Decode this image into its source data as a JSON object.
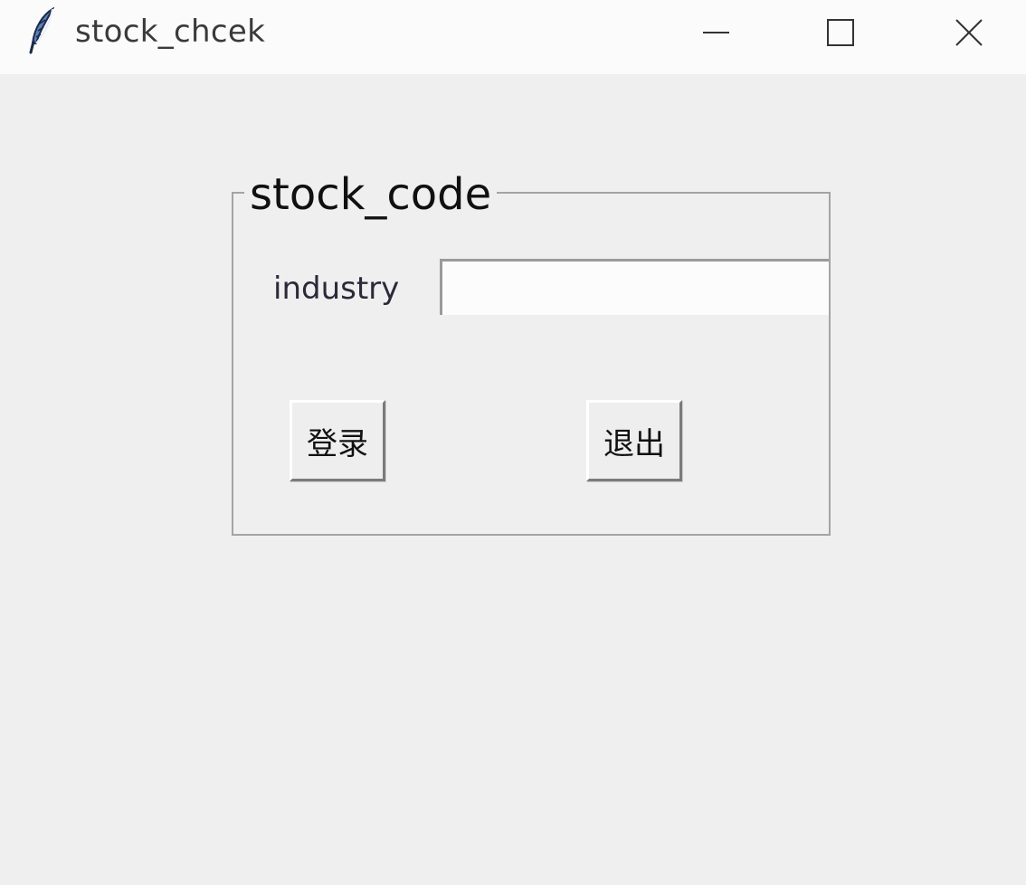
{
  "window": {
    "title": "stock_chcek",
    "icon": "feather-icon",
    "controls": [
      "minimize-icon",
      "maximize-icon",
      "close-icon"
    ]
  },
  "frame": {
    "legend": "stock_code",
    "industry_label": "industry",
    "industry_value": "",
    "buttons": {
      "login_label": "登录",
      "exit_label": "退出"
    }
  }
}
